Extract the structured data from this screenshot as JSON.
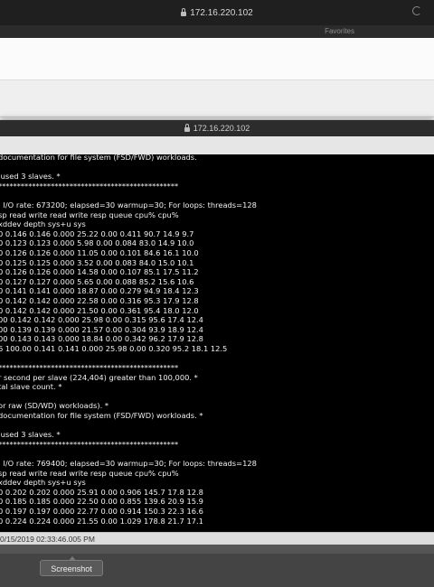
{
  "back_window": {
    "url": "172.16.220.102",
    "favorites_label": "Favorites"
  },
  "front_window": {
    "url": "172.16.220.102",
    "terminal_lines": [
      "documentation for file system (FSD/FWD) workloads.",
      "",
      " used 3 slaves. *",
      "************************************************",
      "",
      "; I/O rate: 673200; elapsed=30 warmup=30; For loops: threads=128",
      "sp read write read write resp queue cpu% cpu%",
      "xddev depth sys+u sys",
      "0 0.146 0.146 0.000 25.22 0.00 0.411 90.7 14.9 9.7",
      "0 0.123 0.123 0.000 5.98 0.00 0.084 83.0 14.9 10.0",
      "0 0.126 0.126 0.000 11.05 0.00 0.101 84.6 16.1 10.0",
      "0 0.125 0.125 0.000 3.52 0.00 0.083 84.0 15.0 10.1",
      "0 0.126 0.126 0.000 14.58 0.00 0.107 85.1 17.5 11.2",
      "0 0.127 0.127 0.000 5.65 0.00 0.088 85.2 15.6 10.6",
      "0 0.141 0.141 0.000 18.87 0.00 0.279 94.9 18.4 12.3",
      "0 0.142 0.142 0.000 22.58 0.00 0.316 95.3 17.9 12.8",
      "0 0.142 0.142 0.000 21.50 0.00 0.361 95.4 18.0 12.0",
      "00 0.142 0.142 0.000 25.98 0.00 0.315 95.6 17.4 12.4",
      "00 0.139 0.139 0.000 21.57 0.00 0.304 93.9 18.9 12.4",
      "00 0.143 0.143 0.000 18.84 0.00 0.342 96.2 17.9 12.8",
      "6 100.00 0.141 0.141 0.000 25.98 0.00 0.320 95.2 18.1 12.5",
      "",
      "************************************************",
      "r second per slave (224,404) greater than 100,000. *",
      "tal slave count. *",
      "",
      "or raw (SD/WD) workloads). *",
      "documentation for file system (FSD/FWD) workloads. *",
      "",
      " used 3 slaves. *",
      "************************************************",
      "",
      "; I/O rate: 769400; elapsed=30 warmup=30; For loops: threads=128",
      "sp read write read write resp queue cpu% cpu%",
      "xddev depth sys+u sys",
      "0 0.202 0.202 0.000 25.91 0.00 0.906 145.7 17.8 12.8",
      "0 0.185 0.185 0.000 22.50 0.00 0.855 139.6 20.9 15.9",
      "0 0.197 0.197 0.000 22.77 0.00 0.914 150.3 22.3 16.6",
      "0 0.224 0.224 0.000 21.55 0.00 1.029 178.8 21.7 17.1"
    ],
    "status_text": "0/15/2019 02:33:46.005 PM"
  },
  "tooltip": {
    "label": "Screenshot"
  }
}
